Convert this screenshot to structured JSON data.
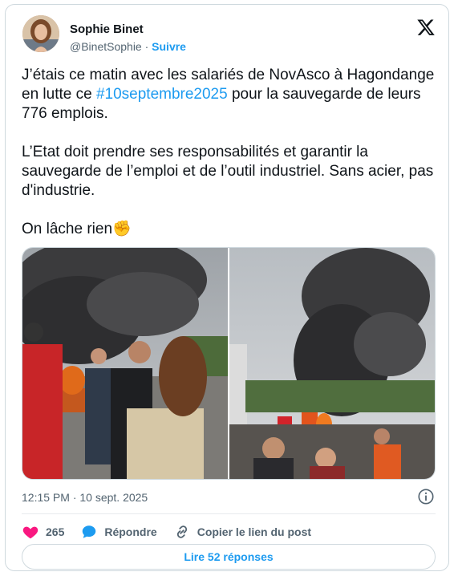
{
  "author": {
    "name": "Sophie Binet",
    "handle": "@BinetSophie",
    "separator": " · ",
    "follow_label": "Suivre"
  },
  "tweet": {
    "p1_before": "J’étais ce matin avec les salariés de NovAsco à Hagondange en lutte ce ",
    "p1_hashtag": "#10septembre2025",
    "p1_after": " pour la sauvegarde de leurs 776 emplois.",
    "p2": "L’Etat doit prendre ses responsabilités et garantir la sauvegarde de l’emploi et de l’outil industriel. Sans acier, pas d'industrie.",
    "p3": "On lâche rien",
    "p3_emoji": "✊"
  },
  "timestamp": "12:15 PM · 10 sept. 2025",
  "actions": {
    "likes": "265",
    "reply_label": "Répondre",
    "copy_link_label": "Copier le lien du post"
  },
  "replies_button": "Lire 52 réponses",
  "colors": {
    "accent": "#1d9bf0",
    "like": "#f91880",
    "text": "#0f1419",
    "muted": "#536471",
    "border": "#cfd9de"
  },
  "icons": [
    "x-logo-icon",
    "info-icon",
    "heart-icon",
    "reply-bubble-icon",
    "link-icon"
  ]
}
